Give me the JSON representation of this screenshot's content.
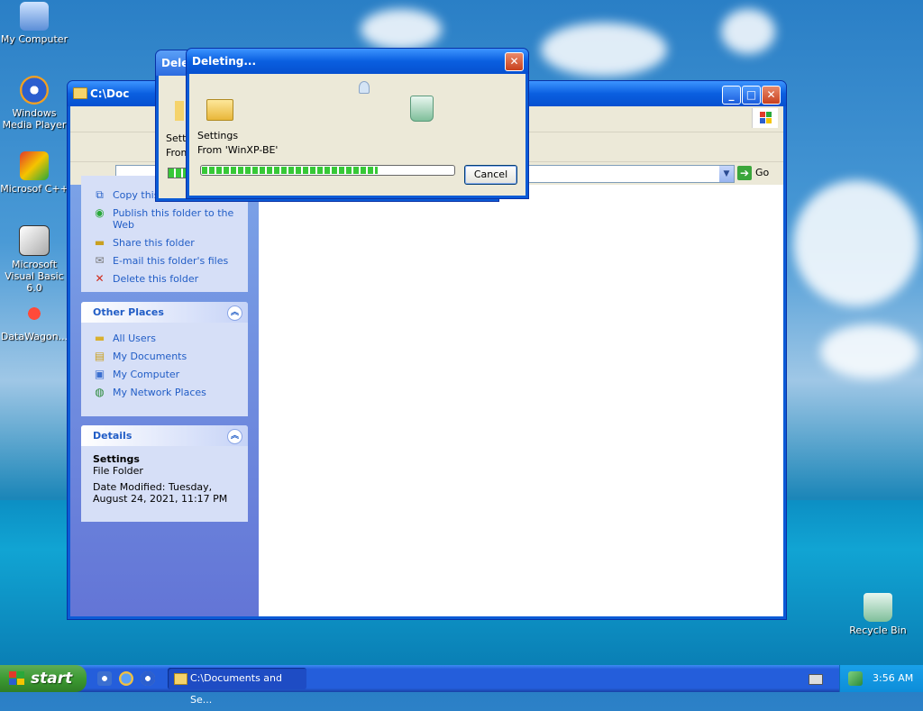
{
  "desktop": {
    "icons": [
      {
        "label": "My Computer"
      },
      {
        "label": "Windows Media Player"
      },
      {
        "label": "Microsof C++"
      },
      {
        "label": "Microsoft Visual Basic 6.0"
      },
      {
        "label": "DataWagon..."
      },
      {
        "label": "Recycle Bin"
      }
    ]
  },
  "explorer": {
    "title": "C:\\Documents and Settings",
    "title_short": "C:\\Doc",
    "go_label": "Go",
    "file_folder_tasks": [
      {
        "label": "Copy this folder",
        "icon": "copy-folder-icon"
      },
      {
        "label": "Publish this folder to the Web",
        "icon": "publish-web-icon"
      },
      {
        "label": "Share this folder",
        "icon": "share-folder-icon"
      },
      {
        "label": "E-mail this folder's files",
        "icon": "email-icon"
      },
      {
        "label": "Delete this folder",
        "icon": "delete-icon"
      }
    ],
    "other_places": {
      "title": "Other Places",
      "items": [
        {
          "label": "All Users",
          "icon": "folder-icon"
        },
        {
          "label": "My Documents",
          "icon": "my-documents-icon"
        },
        {
          "label": "My Computer",
          "icon": "my-computer-icon"
        },
        {
          "label": "My Network Places",
          "icon": "network-icon"
        }
      ]
    },
    "details": {
      "title": "Details",
      "name": "Settings",
      "type": "File Folder",
      "modified": "Date Modified: Tuesday, August 24, 2021, 11:17 PM"
    }
  },
  "back_dialog": {
    "title": "Dele",
    "line1": "Settin",
    "line2": "From"
  },
  "dialog": {
    "title": "Deleting...",
    "item": "Settings",
    "from": "From 'WinXP-BE'",
    "progress": 0.7,
    "cancel_label": "Cancel"
  },
  "taskbar": {
    "start_label": "start",
    "task_label": "C:\\Documents and Se...",
    "clock": "3:56 AM"
  },
  "colors": {
    "xp_blue": "#0a5fe0",
    "start_green": "#3c9a32",
    "link_blue": "#215dc6",
    "progress_green": "#37c837"
  }
}
